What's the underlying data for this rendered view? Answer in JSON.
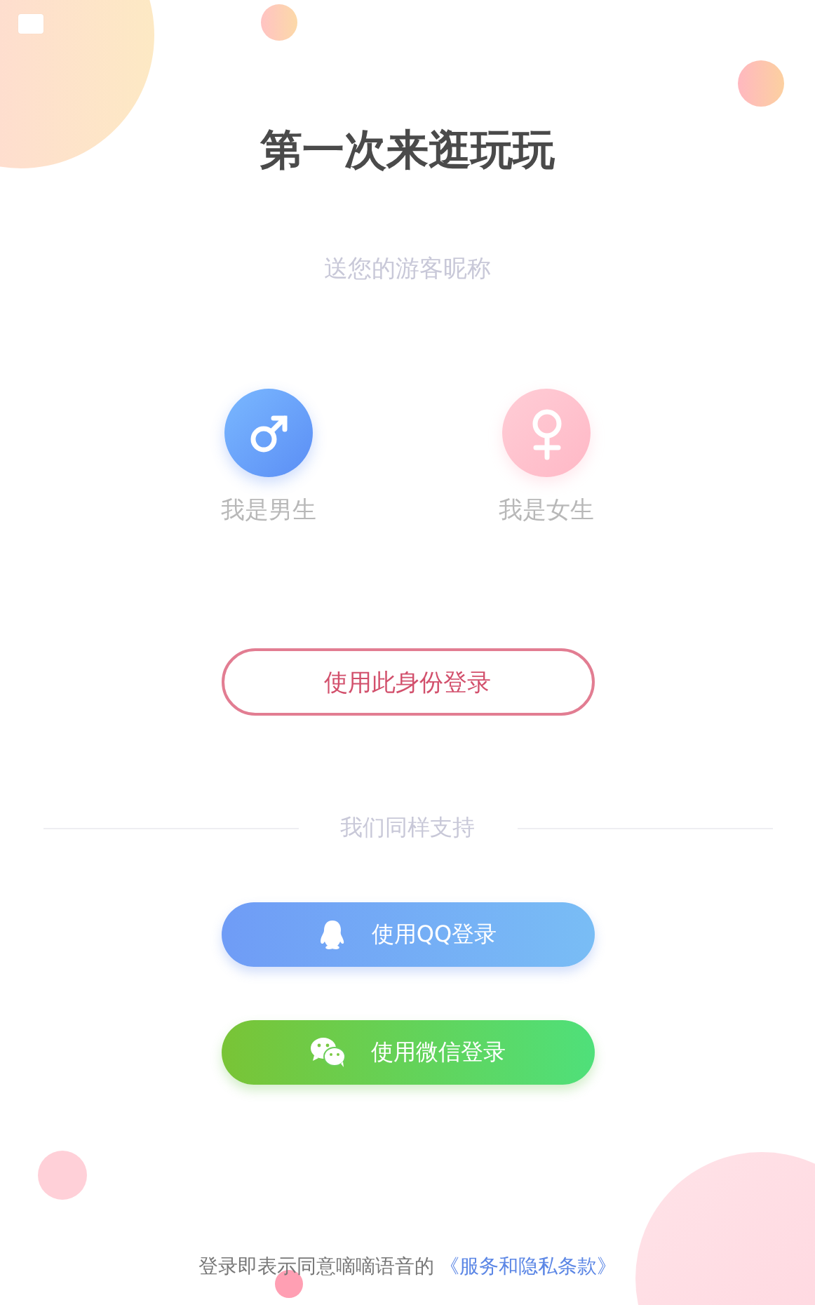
{
  "title": "第一次来逛玩玩",
  "subtitle": "送您的游客昵称",
  "genders": [
    {
      "kind": "male",
      "label": "我是男生"
    },
    {
      "kind": "female",
      "label": "我是女生"
    }
  ],
  "identity_button": "使用此身份登录",
  "divider_label": "我们同样支持",
  "social_logins": [
    {
      "kind": "qq",
      "label": "使用QQ登录"
    },
    {
      "kind": "wechat",
      "label": "使用微信登录"
    }
  ],
  "footer": {
    "text": "登录即表示同意嘀嘀语音的",
    "link": "《服务和隐私条款》"
  }
}
